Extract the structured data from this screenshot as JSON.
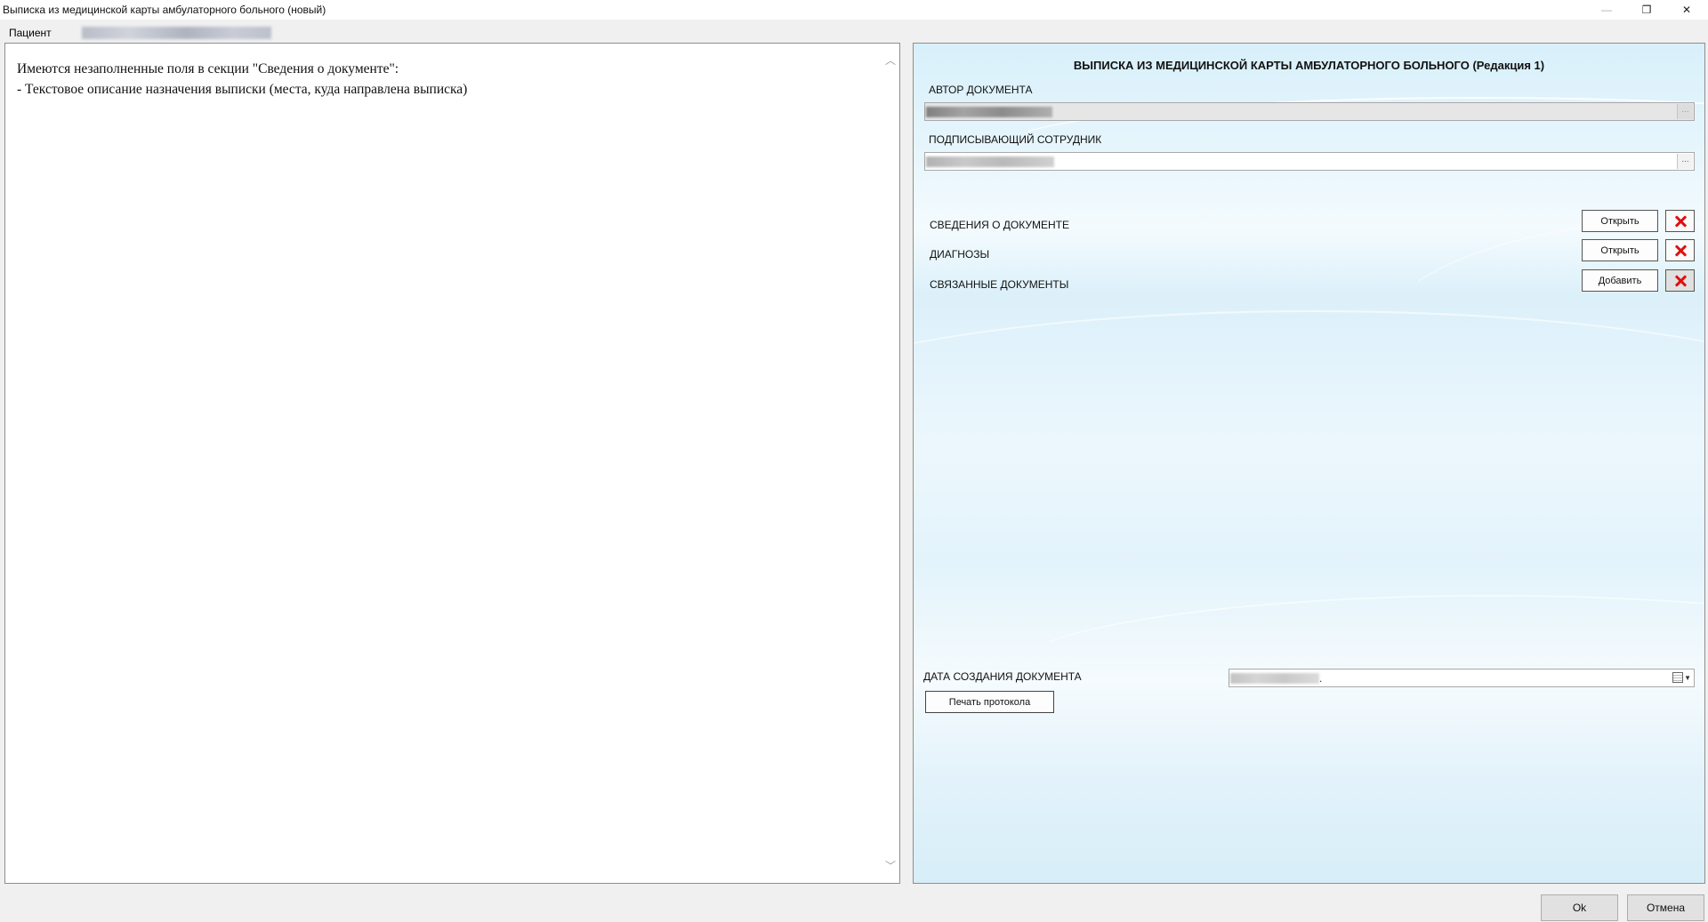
{
  "window": {
    "title": "Выписка из медицинской карты амбулаторного больного (новый)",
    "minimize_glyph": "—",
    "maximize_glyph": "❐",
    "close_glyph": "✕"
  },
  "patient": {
    "label": "Пациент",
    "value": ""
  },
  "messages": {
    "line1": "Имеются незаполненные поля в секции \"Сведения о документе\":",
    "line2": "- Текстовое описание назначения выписки (места, куда направлена выписка)"
  },
  "scroll": {
    "up_glyph": "︿",
    "down_glyph": "﹀"
  },
  "document": {
    "title": "ВЫПИСКА ИЗ МЕДИЦИНСКОЙ КАРТЫ АМБУЛАТОРНОГО БОЛЬНОГО (Редакция 1)",
    "author_label": "АВТОР ДОКУМЕНТА",
    "signer_label": "ПОДПИСЫВАЮЩИЙ СОТРУДНИК",
    "dots": "...",
    "sections": [
      {
        "label": "СВЕДЕНИЯ О ДОКУМЕНТЕ",
        "button": "Открыть"
      },
      {
        "label": "ДИАГНОЗЫ",
        "button": "Открыть"
      },
      {
        "label": "СВЯЗАННЫЕ ДОКУМЕНТЫ",
        "button": "Добавить"
      }
    ],
    "date_label": "ДАТА СОЗДАНИЯ ДОКУМЕНТА",
    "date_suffix": ".",
    "calendar_arrow": "▼",
    "print_button": "Печать протокола"
  },
  "footer": {
    "ok": "Ok",
    "cancel": "Отмена"
  },
  "colors": {
    "delete_icon": "#dd1111",
    "panel_background": "#e4f4fc"
  }
}
